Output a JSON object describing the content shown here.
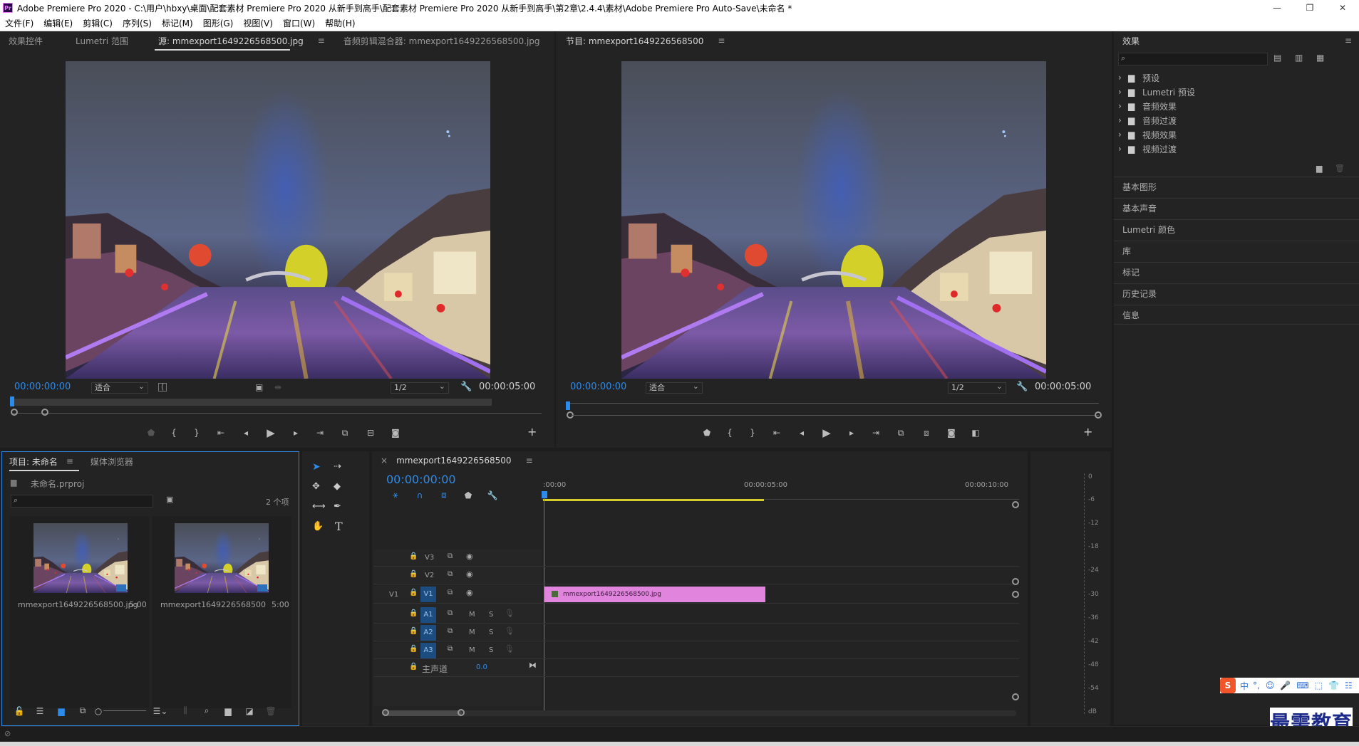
{
  "window": {
    "app_logo_text": "Pr",
    "title": "Adobe Premiere Pro 2020 - C:\\用户\\hbxy\\桌面\\配套素材 Premiere Pro 2020 从新手到高手\\配套素材 Premiere Pro 2020 从新手到高手\\第2章\\2.4.4\\素材\\Adobe Premiere Pro Auto-Save\\未命名 *",
    "controls": [
      "—",
      "❐",
      "✕"
    ]
  },
  "menu": [
    "文件(F)",
    "编辑(E)",
    "剪辑(C)",
    "序列(S)",
    "标记(M)",
    "图形(G)",
    "视图(V)",
    "窗口(W)",
    "帮助(H)"
  ],
  "source_panel": {
    "tabs": [
      "效果控件",
      "Lumetri 范围",
      "源: mmexport1649226568500.jpg",
      "音频剪辑混合器: mmexport1649226568500.jpg"
    ],
    "menu_icon": "≡",
    "more_icon": "»",
    "timecode_current": "00:00:00:00",
    "fit": "适合",
    "resolution": "1/2",
    "timecode_duration": "00:00:05:00"
  },
  "program_panel": {
    "title": "节目: mmexport1649226568500",
    "menu_icon": "≡",
    "timecode_current": "00:00:00:00",
    "fit": "适合",
    "resolution": "1/2",
    "timecode_duration": "00:00:05:00"
  },
  "effects_panel": {
    "title": "效果",
    "menu_icon": "≡",
    "search_placeholder": "",
    "folders": [
      "预设",
      "Lumetri 预设",
      "音频效果",
      "音频过渡",
      "视频效果",
      "视频过渡"
    ]
  },
  "side_panels": [
    "基本图形",
    "基本声音",
    "Lumetri 颜色",
    "库",
    "标记",
    "历史记录",
    "信息"
  ],
  "project_panel": {
    "tabs": [
      "项目: 未命名",
      "媒体浏览器"
    ],
    "menu_icon": "≡",
    "project_file": "未命名.prproj",
    "item_count": "2 个项",
    "items": [
      {
        "name": "mmexport1649226568500.jpg",
        "duration": "5:00"
      },
      {
        "name": "mmexport1649226568500",
        "duration": "5:00"
      }
    ]
  },
  "timeline": {
    "sequence_name": "mmexport1649226568500",
    "close_icon": "×",
    "menu_icon": "≡",
    "timecode": "00:00:00:00",
    "ruler": [
      ":00:00",
      "00:00:05:00",
      "00:00:10:00"
    ],
    "video_tracks": [
      "V3",
      "V2",
      "V1"
    ],
    "audio_tracks": [
      "A1",
      "A2",
      "A3"
    ],
    "source_patch": "V1",
    "master_label": "主声道",
    "master_value": "0.0",
    "clip_name": "mmexport1649226568500.jpg",
    "mute": "M",
    "solo": "S"
  },
  "audio_meter": {
    "ticks": [
      "0",
      "-6",
      "-12",
      "-18",
      "-24",
      "-30",
      "-36",
      "-42",
      "-48",
      "-54",
      "dB"
    ]
  },
  "tools": {
    "type_tool": "T"
  },
  "ime": {
    "mode": "中",
    "punct": "°,"
  },
  "watermark": "最需教育",
  "colors": {
    "accent_blue": "#2d8ceb",
    "clip_pink": "#e084de",
    "work_area_yellow": "#d6cd2b",
    "panel_bg": "#232323",
    "track_target": "#1d4d80"
  }
}
